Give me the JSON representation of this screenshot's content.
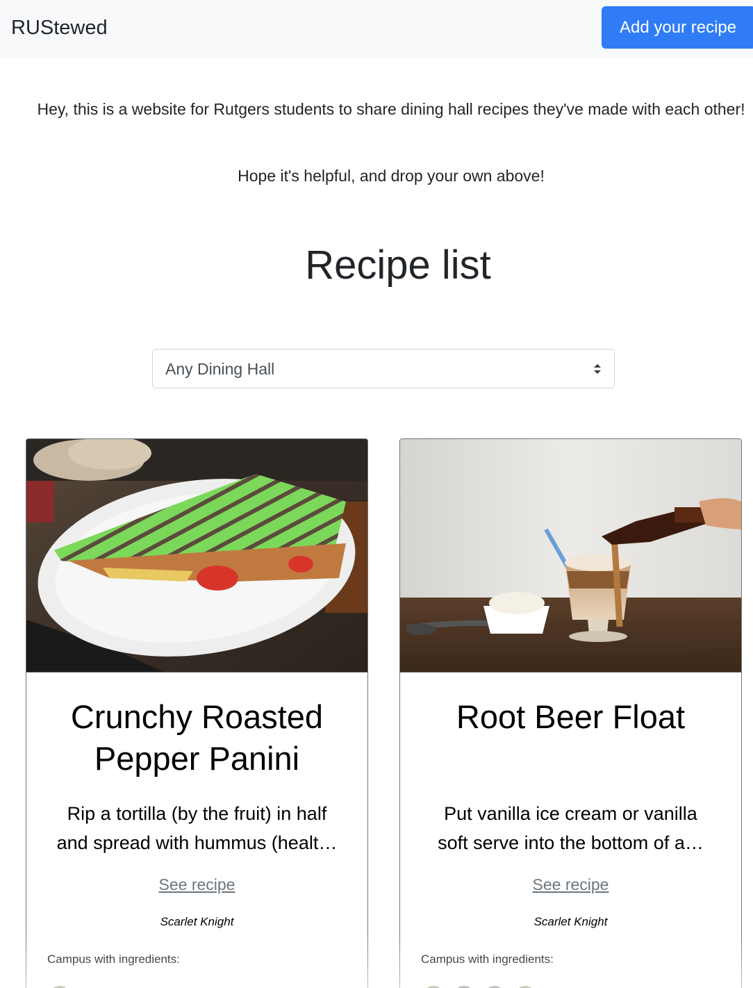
{
  "navbar": {
    "brand": "RUStewed",
    "add_button": "Add your recipe"
  },
  "intro": {
    "line1": "Hey, this is a website for Rutgers students to share dining hall recipes they've made with each other!",
    "line2": "Hope it's helpful, and drop your own above!"
  },
  "recipe_list": {
    "title": "Recipe list",
    "filter": {
      "selected": "Any Dining Hall"
    },
    "cards": [
      {
        "title": "Crunchy Roasted Pepper Panini",
        "desc_line1": "Rip a tortilla (by the fruit) in half",
        "desc_line2": "and spread with hummus (healt…",
        "link": "See recipe",
        "author": "Scarlet Knight",
        "campus_label": "Campus with ingredients:",
        "image": "panini-photo"
      },
      {
        "title": "Root Beer Float",
        "desc_line1": "Put vanilla ice cream or vanilla",
        "desc_line2": "soft serve into the bottom of a…",
        "link": "See recipe",
        "author": "Scarlet Knight",
        "campus_label": "Campus with ingredients:",
        "image": "root-beer-float-photo"
      }
    ]
  },
  "colors": {
    "primary": "#2f7cf6",
    "navbar_bg": "#f8f9fa",
    "link": "#6c757d"
  }
}
